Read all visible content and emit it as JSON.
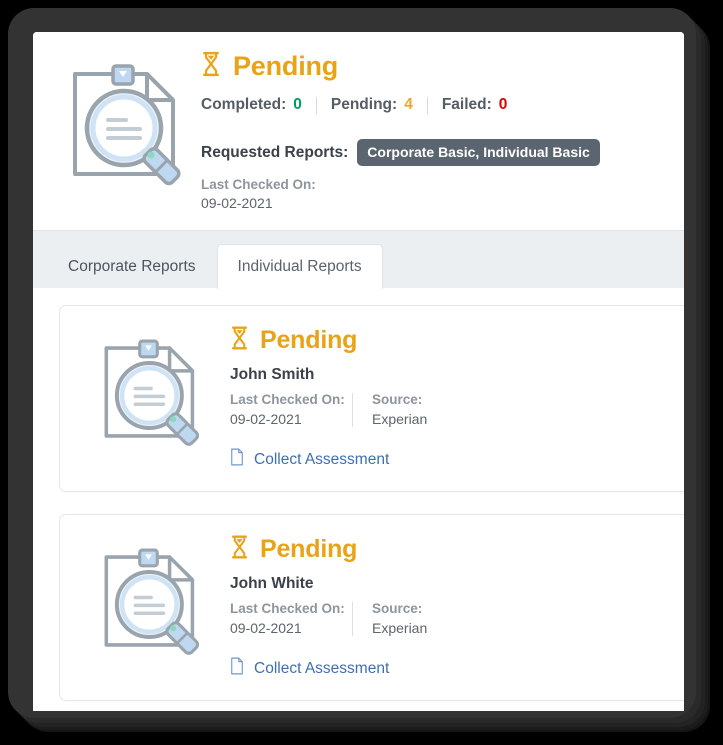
{
  "summary": {
    "status_icon": "hourglass-icon",
    "status_text": "Pending",
    "counts": [
      {
        "label": "Completed:",
        "value": "0",
        "tone": "completed"
      },
      {
        "label": "Pending:",
        "value": "4",
        "tone": "pending"
      },
      {
        "label": "Failed:",
        "value": "0",
        "tone": "failed"
      }
    ],
    "requested_label": "Requested Reports:",
    "requested_badge": "Corporate Basic, Individual Basic",
    "last_checked_label": "Last Checked On:",
    "last_checked_value": "09-02-2021",
    "document_search_icon": "document-search-icon"
  },
  "tabs": [
    {
      "label": "Corporate Reports",
      "active": false
    },
    {
      "label": "Individual Reports",
      "active": true
    }
  ],
  "reports": [
    {
      "status_icon": "hourglass-icon",
      "status_text": "Pending",
      "name": "John Smith",
      "last_checked_label": "Last Checked On:",
      "last_checked_value": "09-02-2021",
      "source_label": "Source:",
      "source_value": "Experian",
      "action_icon": "file-icon",
      "action_label": "Collect Assessment"
    },
    {
      "status_icon": "hourglass-icon",
      "status_text": "Pending",
      "name": "John White",
      "last_checked_label": "Last Checked On:",
      "last_checked_value": "09-02-2021",
      "source_label": "Source:",
      "source_value": "Experian",
      "action_icon": "file-icon",
      "action_label": "Collect Assessment"
    }
  ],
  "colors": {
    "status_amber": "#e8a317",
    "count_completed": "#009e5c",
    "count_pending": "#f0a821",
    "count_failed": "#e00000",
    "badge_bg": "#5a6570",
    "link_blue": "#3d6fb4",
    "tabbar_bg": "#eceff1",
    "bezel": "#333333"
  }
}
